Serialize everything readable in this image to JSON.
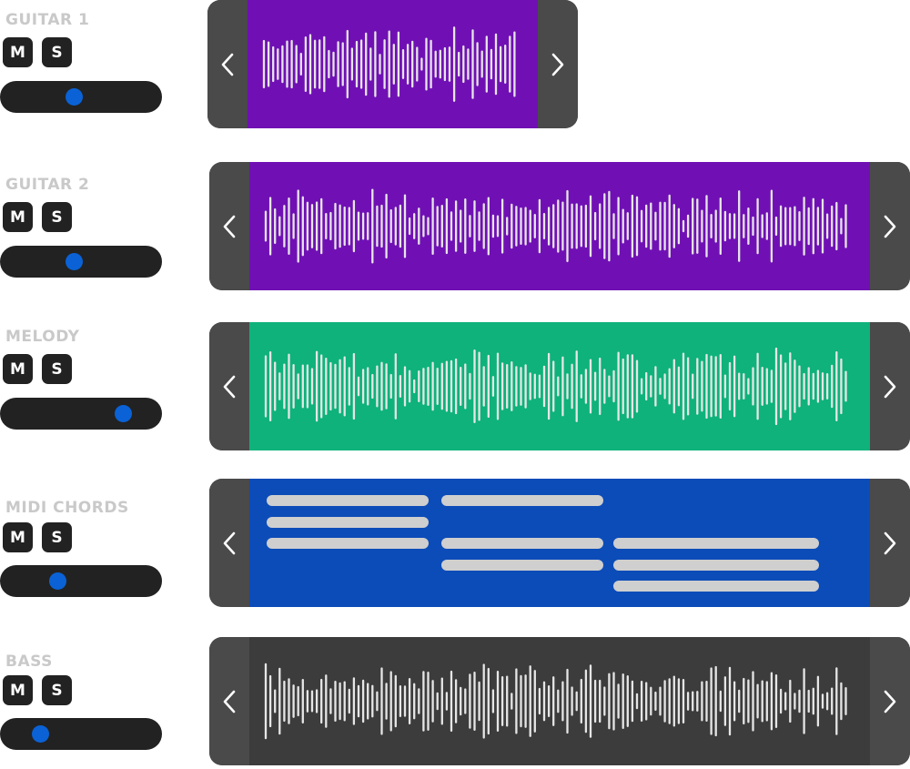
{
  "colors": {
    "name_text": "#c9c9c9",
    "button_bg": "#222222",
    "knob": "#0a62d6",
    "nav_bg": "#4a4a4a",
    "wave": "#e6e6e6",
    "note": "#cfcfcf"
  },
  "tracks": [
    {
      "name": "GUITAR 1",
      "mute_label": "M",
      "solo_label": "S",
      "volume": 0.45,
      "clip": {
        "type": "audio",
        "color": "#7010b4",
        "prev_icon": "chevron-left-icon",
        "next_icon": "chevron-right-icon",
        "seed": 3
      }
    },
    {
      "name": "GUITAR 2",
      "mute_label": "M",
      "solo_label": "S",
      "volume": 0.45,
      "clip": {
        "type": "audio",
        "color": "#7010b4",
        "prev_icon": "chevron-left-icon",
        "next_icon": "chevron-right-icon",
        "seed": 7
      }
    },
    {
      "name": "MELODY",
      "mute_label": "M",
      "solo_label": "S",
      "volume": 0.79,
      "clip": {
        "type": "audio",
        "color": "#0eb27a",
        "prev_icon": "chevron-left-icon",
        "next_icon": "chevron-right-icon",
        "seed": 11
      }
    },
    {
      "name": "MIDI CHORDS",
      "mute_label": "M",
      "solo_label": "S",
      "volume": 0.34,
      "clip": {
        "type": "midi",
        "color": "#0c4cb8",
        "prev_icon": "chevron-left-icon",
        "next_icon": "chevron-right-icon",
        "notes": [
          {
            "start": 0.0,
            "end": 0.277,
            "row": 0
          },
          {
            "start": 0.0,
            "end": 0.277,
            "row": 1
          },
          {
            "start": 0.0,
            "end": 0.277,
            "row": 2
          },
          {
            "start": 0.298,
            "end": 0.575,
            "row": 0
          },
          {
            "start": 0.298,
            "end": 0.575,
            "row": 2
          },
          {
            "start": 0.298,
            "end": 0.575,
            "row": 3
          },
          {
            "start": 0.591,
            "end": 0.942,
            "row": 2
          },
          {
            "start": 0.591,
            "end": 0.942,
            "row": 3
          },
          {
            "start": 0.591,
            "end": 0.942,
            "row": 4
          }
        ]
      }
    },
    {
      "name": "BASS",
      "mute_label": "M",
      "solo_label": "S",
      "volume": 0.22,
      "clip": {
        "type": "audio",
        "color": "#3c3c3c",
        "prev_icon": "chevron-left-icon",
        "next_icon": "chevron-right-icon",
        "seed": 19
      }
    }
  ]
}
